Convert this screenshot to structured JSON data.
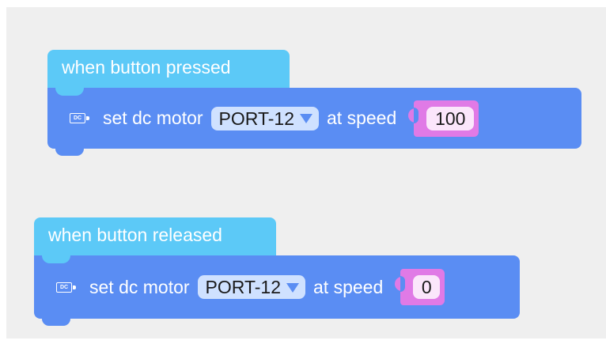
{
  "workspace": {
    "background": "#efefef",
    "blocks": [
      {
        "event_label": "when button pressed",
        "action": {
          "icon": "dc-motor-icon",
          "icon_text": "DC",
          "prefix": "set dc motor",
          "port": "PORT-12",
          "middle": "at speed",
          "speed": "100"
        }
      },
      {
        "event_label": "when button released",
        "action": {
          "icon": "dc-motor-icon",
          "icon_text": "DC",
          "prefix": "set dc motor",
          "port": "PORT-12",
          "middle": "at speed",
          "speed": "0"
        }
      }
    ]
  },
  "colors": {
    "event_hat": "#5cc9f7",
    "motor_block": "#5a8df3",
    "dropdown": "#cfe1ff",
    "number_socket": "#e07ae6",
    "number_field": "#fbe6fb"
  }
}
